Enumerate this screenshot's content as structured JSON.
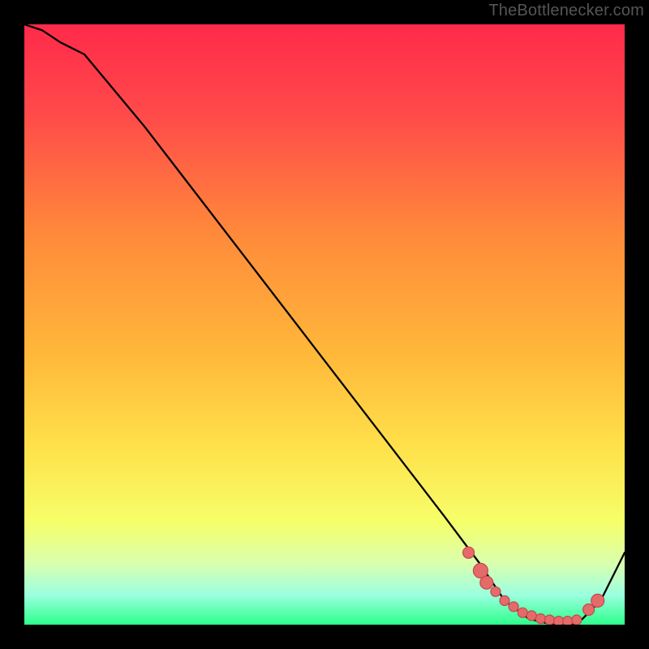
{
  "watermark": "TheBottlenecker.com",
  "colors": {
    "gradient": [
      "#ff2a4a",
      "#ff4a4a",
      "#ff8a3a",
      "#ffb83a",
      "#ffe04a",
      "#f6ff6a",
      "#d8ffb0",
      "#9cffe0",
      "#2cff8a"
    ],
    "dotFill": "#e66a6a",
    "dotStroke": "#c04a4a",
    "curve": "#000000"
  },
  "chart_data": {
    "type": "line",
    "title": "",
    "xlabel": "",
    "ylabel": "",
    "xlim": [
      0,
      100
    ],
    "ylim": [
      0,
      100
    ],
    "grid": false,
    "legend": false,
    "series": [
      {
        "name": "bottleneck-curve",
        "x": [
          0,
          3,
          6,
          10,
          20,
          30,
          40,
          50,
          60,
          70,
          76,
          80,
          84,
          88,
          92,
          96,
          100
        ],
        "values": [
          100,
          99,
          97,
          95,
          83,
          70,
          57,
          44,
          31,
          18,
          10,
          4,
          1,
          0,
          0,
          4,
          12
        ]
      }
    ],
    "highlight_points": {
      "name": "dense-markers",
      "x": [
        74,
        76,
        77,
        78.5,
        80,
        81.5,
        83,
        84.5,
        86,
        87.5,
        89,
        90.5,
        92,
        94,
        95.5
      ],
      "values": [
        12,
        9,
        7,
        5.5,
        4,
        3,
        2,
        1.5,
        1,
        0.8,
        0.6,
        0.6,
        0.8,
        2.5,
        4
      ],
      "r": [
        7,
        9,
        8,
        6,
        6,
        6,
        6,
        6,
        6,
        6,
        6,
        6,
        6,
        7,
        8
      ]
    }
  }
}
